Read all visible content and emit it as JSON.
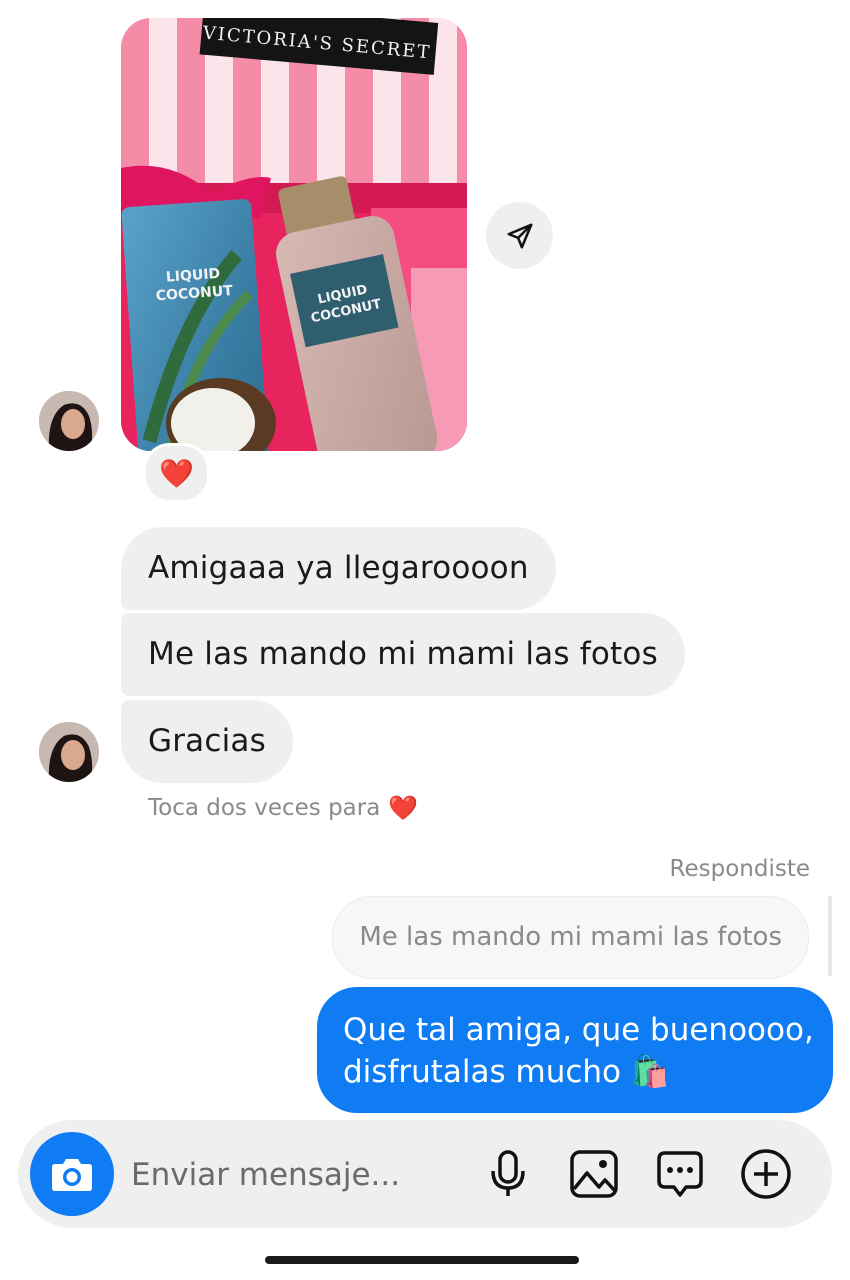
{
  "shared_post": {
    "image_text": {
      "brand": "VICTORIA'S SECRET",
      "product_line1": "LIQUID",
      "product_line2": "COCONUT"
    },
    "reaction": "❤️"
  },
  "messages": [
    {
      "direction": "incoming",
      "text": "Amigaaa ya llegaroooon"
    },
    {
      "direction": "incoming",
      "text": "Me las mando mi mami las fotos"
    },
    {
      "direction": "incoming",
      "text": "Gracias"
    }
  ],
  "double_tap_hint": {
    "text": "Toca dos veces para",
    "emoji": "❤️"
  },
  "reply": {
    "label": "Respondiste",
    "quoted_text": "Me las mando mi mami las fotos",
    "lines": [
      "Que tal amiga, que buenoooo,",
      "disfrutalas mucho 🛍️"
    ]
  },
  "composer": {
    "placeholder": "Enviar mensaje...",
    "icons": [
      "camera-icon",
      "microphone-icon",
      "gallery-icon",
      "sticker-icon",
      "plus-icon"
    ]
  },
  "colors": {
    "accent": "#0f7cf4",
    "bubble_incoming": "#efefef",
    "text_muted": "#8a8a8a"
  }
}
